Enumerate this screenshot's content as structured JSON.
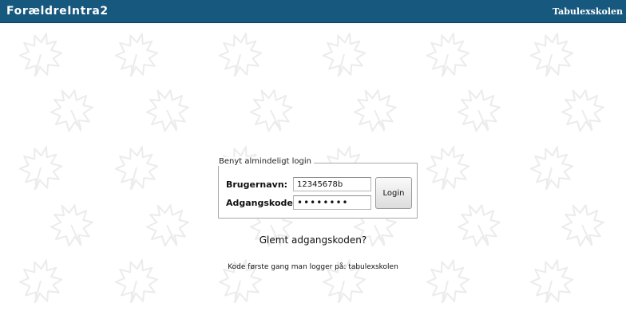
{
  "header": {
    "app_title": "ForældreIntra2",
    "school_name": "Tabulexskolen"
  },
  "login": {
    "legend": "Benyt almindeligt login",
    "username_label": "Brugernavn:",
    "username_value": "12345678b",
    "password_label": "Adgangskode:",
    "password_value": "••••••••",
    "button_label": "Login"
  },
  "forgot_password_link": "Glemt adgangskoden?",
  "first_login_hint": "Kode første gang man logger på: tabulexskolen",
  "colors": {
    "header_bg": "#17587f",
    "leaf_watermark": "#ececec"
  },
  "background": {
    "pattern_icon": "leaf-icon"
  }
}
